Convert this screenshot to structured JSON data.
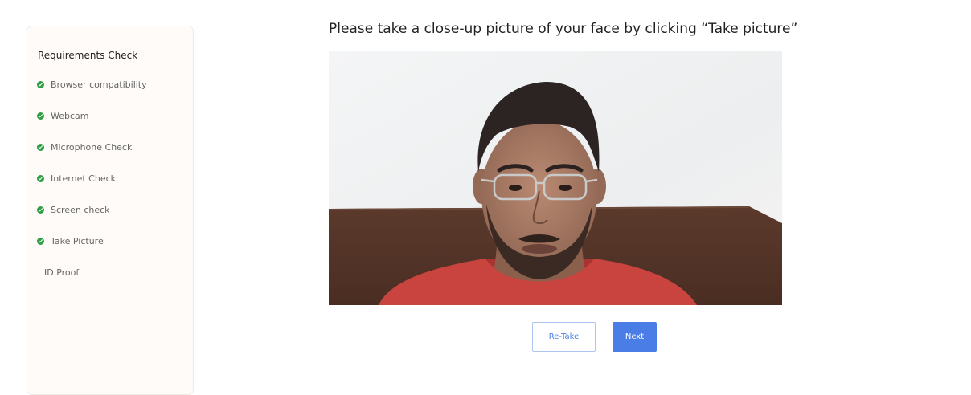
{
  "sidebar": {
    "title": "Requirements Check",
    "items": [
      {
        "label": "Browser compatibility",
        "status": "complete"
      },
      {
        "label": "Webcam",
        "status": "complete"
      },
      {
        "label": "Microphone Check",
        "status": "complete"
      },
      {
        "label": "Internet Check",
        "status": "complete"
      },
      {
        "label": "Screen check",
        "status": "complete"
      },
      {
        "label": "Take Picture",
        "status": "complete"
      },
      {
        "label": "ID Proof",
        "status": "pending"
      }
    ]
  },
  "main": {
    "instruction": "Please take a close-up picture of your face by clicking “Take picture”",
    "photo": "webcam-capture-portrait"
  },
  "actions": {
    "retake_label": "Re-Take",
    "next_label": "Next"
  },
  "colors": {
    "accent": "#4a7ee6",
    "success": "#2f9e44",
    "sidebar_background": "#fefbf8"
  }
}
